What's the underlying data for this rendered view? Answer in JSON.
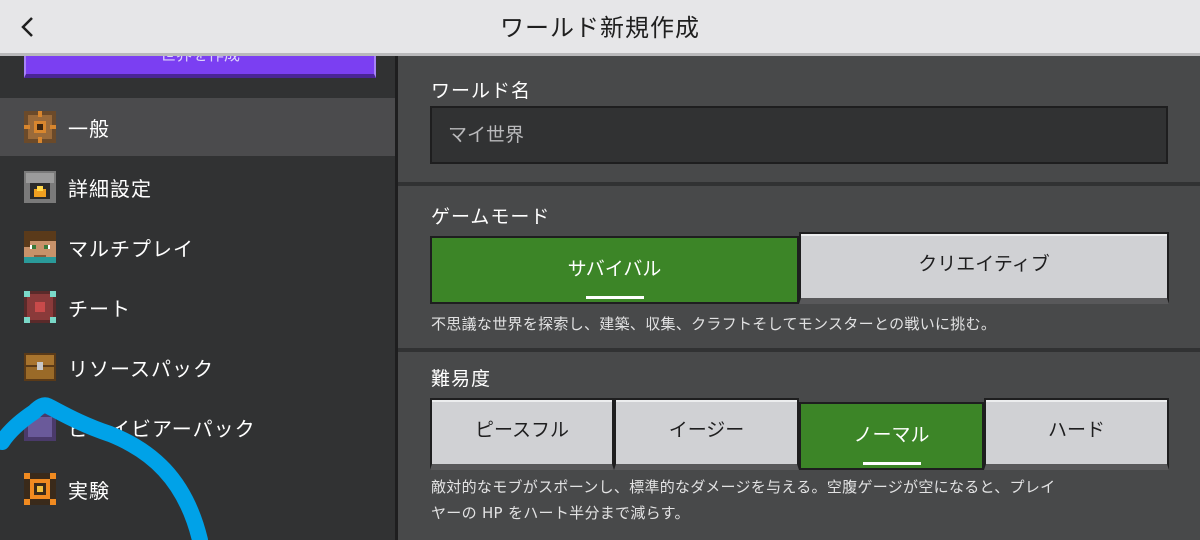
{
  "header": {
    "title": "ワールド新規作成",
    "back_icon": "chevron-left-icon"
  },
  "sidebar": {
    "create_button_label": "世界を作成",
    "items": [
      {
        "label": "一般",
        "icon": "gear-block-icon",
        "active": true
      },
      {
        "label": "詳細設定",
        "icon": "furnace-icon",
        "active": false
      },
      {
        "label": "マルチプレイ",
        "icon": "player-head-icon",
        "active": false
      },
      {
        "label": "チート",
        "icon": "command-block-icon",
        "active": false
      },
      {
        "label": "リソースパック",
        "icon": "chest-icon",
        "active": false
      },
      {
        "label": "ビヘイビアーパック",
        "icon": "behavior-pack-icon",
        "active": false
      },
      {
        "label": "実験",
        "icon": "experiments-icon",
        "active": false
      }
    ]
  },
  "world_name": {
    "label": "ワールド名",
    "placeholder": "マイ世界"
  },
  "game_mode": {
    "label": "ゲームモード",
    "options": [
      "サバイバル",
      "クリエイティブ"
    ],
    "selected": "サバイバル",
    "description": "不思議な世界を探索し、建築、収集、クラフトそしてモンスターとの戦いに挑む。"
  },
  "difficulty": {
    "label": "難易度",
    "options": [
      "ピースフル",
      "イージー",
      "ノーマル",
      "ハード"
    ],
    "selected": "ノーマル",
    "description_line1": "敵対的なモブがスポーンし、標準的なダメージを与える。空腹ゲージが空になると、プレイ",
    "description_line2": "ヤーの HP をハート半分まで減らす。"
  },
  "colors": {
    "selected_green": "#3c8527",
    "button_gray": "#d0d1d4",
    "panel": "#48494a",
    "sidebar": "#313233",
    "header": "#e6e6e8",
    "create_purple": "#7b3ff2",
    "annotation_stroke": "#00a2e8"
  }
}
